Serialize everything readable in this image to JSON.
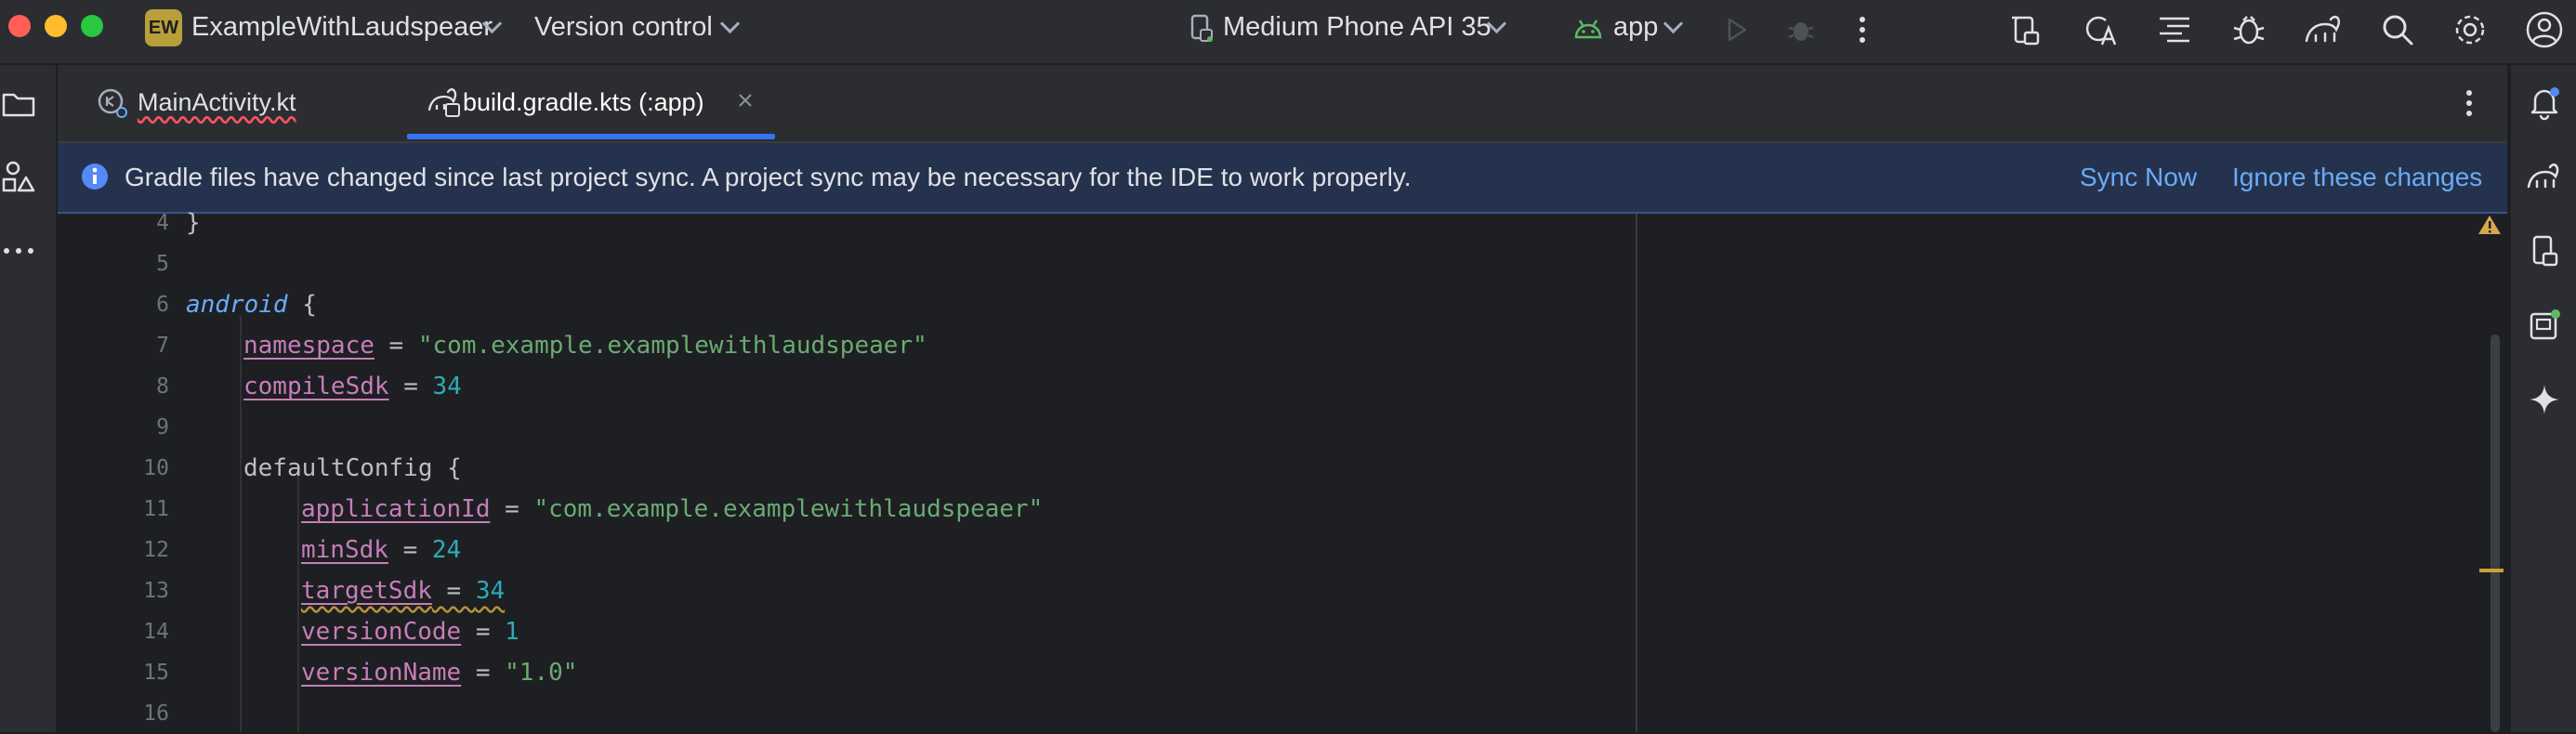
{
  "titlebar": {
    "project_badge": "EW",
    "project_name": "ExampleWithLaudspeaer",
    "vcs": "Version control",
    "device": "Medium Phone API 35",
    "run_config": "app"
  },
  "tabs": [
    {
      "label": "MainActivity.kt",
      "active": false
    },
    {
      "label": "build.gradle.kts (:app)",
      "active": true
    }
  ],
  "banner": {
    "message": "Gradle files have changed since last project sync. A project sync may be necessary for the IDE to work properly.",
    "sync_now": "Sync Now",
    "ignore": "Ignore these changes"
  },
  "editor": {
    "line_numbers": [
      "4",
      "5",
      "6",
      "7",
      "8",
      "9",
      "10",
      "11",
      "12",
      "13",
      "14",
      "15",
      "16"
    ],
    "code": {
      "l4_brace": "}",
      "l6_kw": "android",
      "l6_brace": "{",
      "l7_prop": "namespace",
      "l7_op": " = ",
      "l7_str": "\"com.example.examplewithlaudspeaer\"",
      "l8_prop": "compileSdk",
      "l8_op": " = ",
      "l8_num": "34",
      "l10_block": "defaultConfig",
      "l10_brace": " {",
      "l11_prop": "applicationId",
      "l11_op": " = ",
      "l11_str": "\"com.example.examplewithlaudspeaer\"",
      "l12_prop": "minSdk",
      "l12_op": " = ",
      "l12_num": "24",
      "l13_prop": "targetSdk",
      "l13_op": " = ",
      "l13_num": "34",
      "l14_prop": "versionCode",
      "l14_op": " = ",
      "l14_num": "1",
      "l15_prop": "versionName",
      "l15_op": " = ",
      "l15_str": "\"1.0\""
    }
  },
  "colors": {
    "accent": "#3574f0",
    "banner_bg": "#25324d",
    "link": "#6aabf8",
    "warning": "#d4a84b"
  },
  "icons": [
    "folder-icon",
    "structure-icon",
    "more-icon",
    "device-manager-icon",
    "translate-icon",
    "diff-icon",
    "bug-icon",
    "gradle-icon",
    "search-icon",
    "settings-icon",
    "profile-icon",
    "notifications-icon",
    "sparkle-icon",
    "run-icon",
    "debug-icon",
    "info-icon",
    "warning-icon",
    "close-icon"
  ]
}
